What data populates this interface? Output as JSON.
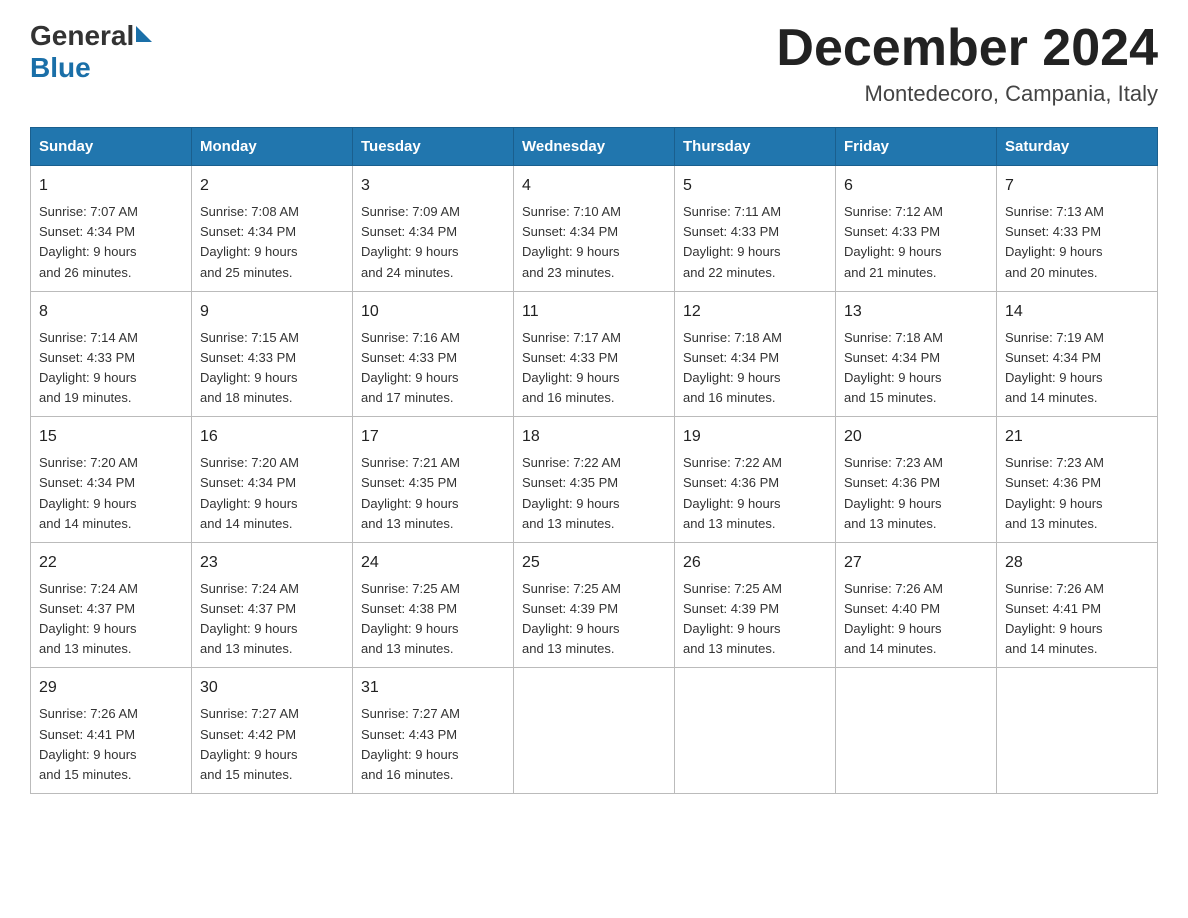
{
  "header": {
    "month": "December 2024",
    "location": "Montedecoro, Campania, Italy",
    "logo_general": "General",
    "logo_blue": "Blue"
  },
  "days_of_week": [
    "Sunday",
    "Monday",
    "Tuesday",
    "Wednesday",
    "Thursday",
    "Friday",
    "Saturday"
  ],
  "weeks": [
    [
      {
        "day": "1",
        "sunrise": "7:07 AM",
        "sunset": "4:34 PM",
        "daylight": "9 hours and 26 minutes."
      },
      {
        "day": "2",
        "sunrise": "7:08 AM",
        "sunset": "4:34 PM",
        "daylight": "9 hours and 25 minutes."
      },
      {
        "day": "3",
        "sunrise": "7:09 AM",
        "sunset": "4:34 PM",
        "daylight": "9 hours and 24 minutes."
      },
      {
        "day": "4",
        "sunrise": "7:10 AM",
        "sunset": "4:34 PM",
        "daylight": "9 hours and 23 minutes."
      },
      {
        "day": "5",
        "sunrise": "7:11 AM",
        "sunset": "4:33 PM",
        "daylight": "9 hours and 22 minutes."
      },
      {
        "day": "6",
        "sunrise": "7:12 AM",
        "sunset": "4:33 PM",
        "daylight": "9 hours and 21 minutes."
      },
      {
        "day": "7",
        "sunrise": "7:13 AM",
        "sunset": "4:33 PM",
        "daylight": "9 hours and 20 minutes."
      }
    ],
    [
      {
        "day": "8",
        "sunrise": "7:14 AM",
        "sunset": "4:33 PM",
        "daylight": "9 hours and 19 minutes."
      },
      {
        "day": "9",
        "sunrise": "7:15 AM",
        "sunset": "4:33 PM",
        "daylight": "9 hours and 18 minutes."
      },
      {
        "day": "10",
        "sunrise": "7:16 AM",
        "sunset": "4:33 PM",
        "daylight": "9 hours and 17 minutes."
      },
      {
        "day": "11",
        "sunrise": "7:17 AM",
        "sunset": "4:33 PM",
        "daylight": "9 hours and 16 minutes."
      },
      {
        "day": "12",
        "sunrise": "7:18 AM",
        "sunset": "4:34 PM",
        "daylight": "9 hours and 16 minutes."
      },
      {
        "day": "13",
        "sunrise": "7:18 AM",
        "sunset": "4:34 PM",
        "daylight": "9 hours and 15 minutes."
      },
      {
        "day": "14",
        "sunrise": "7:19 AM",
        "sunset": "4:34 PM",
        "daylight": "9 hours and 14 minutes."
      }
    ],
    [
      {
        "day": "15",
        "sunrise": "7:20 AM",
        "sunset": "4:34 PM",
        "daylight": "9 hours and 14 minutes."
      },
      {
        "day": "16",
        "sunrise": "7:20 AM",
        "sunset": "4:34 PM",
        "daylight": "9 hours and 14 minutes."
      },
      {
        "day": "17",
        "sunrise": "7:21 AM",
        "sunset": "4:35 PM",
        "daylight": "9 hours and 13 minutes."
      },
      {
        "day": "18",
        "sunrise": "7:22 AM",
        "sunset": "4:35 PM",
        "daylight": "9 hours and 13 minutes."
      },
      {
        "day": "19",
        "sunrise": "7:22 AM",
        "sunset": "4:36 PM",
        "daylight": "9 hours and 13 minutes."
      },
      {
        "day": "20",
        "sunrise": "7:23 AM",
        "sunset": "4:36 PM",
        "daylight": "9 hours and 13 minutes."
      },
      {
        "day": "21",
        "sunrise": "7:23 AM",
        "sunset": "4:36 PM",
        "daylight": "9 hours and 13 minutes."
      }
    ],
    [
      {
        "day": "22",
        "sunrise": "7:24 AM",
        "sunset": "4:37 PM",
        "daylight": "9 hours and 13 minutes."
      },
      {
        "day": "23",
        "sunrise": "7:24 AM",
        "sunset": "4:37 PM",
        "daylight": "9 hours and 13 minutes."
      },
      {
        "day": "24",
        "sunrise": "7:25 AM",
        "sunset": "4:38 PM",
        "daylight": "9 hours and 13 minutes."
      },
      {
        "day": "25",
        "sunrise": "7:25 AM",
        "sunset": "4:39 PM",
        "daylight": "9 hours and 13 minutes."
      },
      {
        "day": "26",
        "sunrise": "7:25 AM",
        "sunset": "4:39 PM",
        "daylight": "9 hours and 13 minutes."
      },
      {
        "day": "27",
        "sunrise": "7:26 AM",
        "sunset": "4:40 PM",
        "daylight": "9 hours and 14 minutes."
      },
      {
        "day": "28",
        "sunrise": "7:26 AM",
        "sunset": "4:41 PM",
        "daylight": "9 hours and 14 minutes."
      }
    ],
    [
      {
        "day": "29",
        "sunrise": "7:26 AM",
        "sunset": "4:41 PM",
        "daylight": "9 hours and 15 minutes."
      },
      {
        "day": "30",
        "sunrise": "7:27 AM",
        "sunset": "4:42 PM",
        "daylight": "9 hours and 15 minutes."
      },
      {
        "day": "31",
        "sunrise": "7:27 AM",
        "sunset": "4:43 PM",
        "daylight": "9 hours and 16 minutes."
      },
      null,
      null,
      null,
      null
    ]
  ],
  "labels": {
    "sunrise": "Sunrise:",
    "sunset": "Sunset:",
    "daylight": "Daylight:"
  }
}
